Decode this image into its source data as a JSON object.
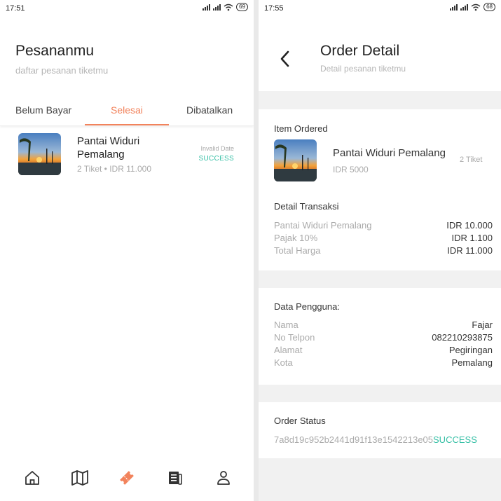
{
  "left": {
    "status_time": "17:51",
    "battery": "69",
    "title": "Pesananmu",
    "subtitle": "daftar pesanan tiketmu",
    "tabs": [
      {
        "label": "Belum Bayar"
      },
      {
        "label": "Selesai",
        "active": true
      },
      {
        "label": "Dibatalkan"
      }
    ],
    "orders": [
      {
        "name": "Pantai Widuri Pemalang",
        "meta": "2 Tiket • IDR 11.000",
        "date": "Invalid Date",
        "status": "SUCCESS"
      }
    ],
    "bottom_nav": [
      {
        "icon": "home-icon"
      },
      {
        "icon": "map-icon"
      },
      {
        "icon": "ticket-icon",
        "active": true
      },
      {
        "icon": "news-icon"
      },
      {
        "icon": "profile-icon"
      }
    ]
  },
  "right": {
    "status_time": "17:55",
    "battery": "68",
    "title": "Order Detail",
    "subtitle": "Detail pesanan tiketmu",
    "item_section": {
      "heading": "Item Ordered",
      "name": "Pantai Widuri Pemalang",
      "qty": "2 Tiket",
      "price": "IDR 5000"
    },
    "transaction": {
      "heading": "Detail Transaksi",
      "rows": [
        {
          "key": "Pantai Widuri Pemalang",
          "value": "IDR 10.000"
        },
        {
          "key": "Pajak 10%",
          "value": "IDR 1.100"
        },
        {
          "key": "Total Harga",
          "value": "IDR 11.000"
        }
      ]
    },
    "user": {
      "heading": "Data Pengguna:",
      "rows": [
        {
          "key": "Nama",
          "value": "Fajar"
        },
        {
          "key": "No Telpon",
          "value": "082210293875"
        },
        {
          "key": "Alamat",
          "value": "Pegiringan"
        },
        {
          "key": "Kota",
          "value": "Pemalang"
        }
      ]
    },
    "order_status": {
      "heading": "Order Status",
      "order_id": "7a8d19c952b2441d91f13e1542213e05",
      "status": "SUCCESS"
    }
  },
  "colors": {
    "accent": "#f2835c",
    "success": "#35bfa5",
    "muted": "#aaaaaa",
    "divider_bg": "#f1f1f1"
  }
}
